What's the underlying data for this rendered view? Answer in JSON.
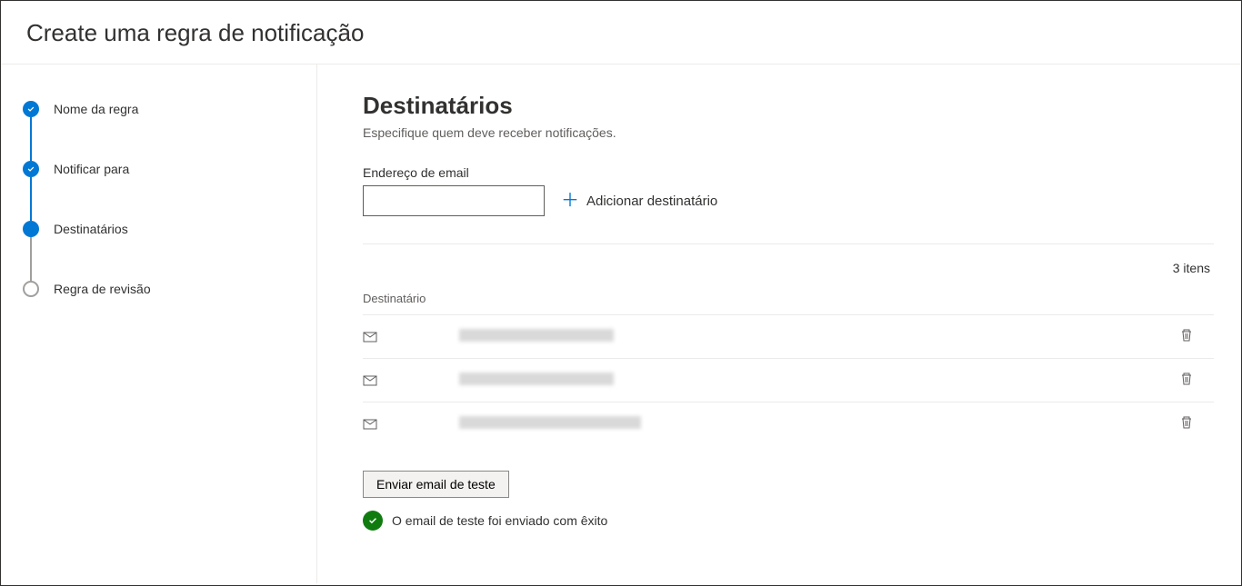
{
  "header": {
    "title": "Create uma regra de notificação"
  },
  "sidebar": {
    "steps": [
      {
        "label": "Nome da regra",
        "state": "completed"
      },
      {
        "label": "Notificar para",
        "state": "completed"
      },
      {
        "label": "Destinatários",
        "state": "current"
      },
      {
        "label": "Regra de revisão",
        "state": "upcoming"
      }
    ]
  },
  "main": {
    "title": "Destinatários",
    "subtitle": "Especifique quem deve receber notificações.",
    "email_label": "Endereço de email",
    "email_value": "",
    "add_label": "Adicionar destinatário",
    "count_value": "3",
    "count_unit": "itens",
    "col_header": "Destinatário",
    "rows": [
      {
        "redacted_width": 170
      },
      {
        "redacted_width": 170
      },
      {
        "redacted_width": 200
      }
    ],
    "test_button": "Enviar email de teste",
    "status_text": "O email de teste foi enviado com êxito"
  }
}
